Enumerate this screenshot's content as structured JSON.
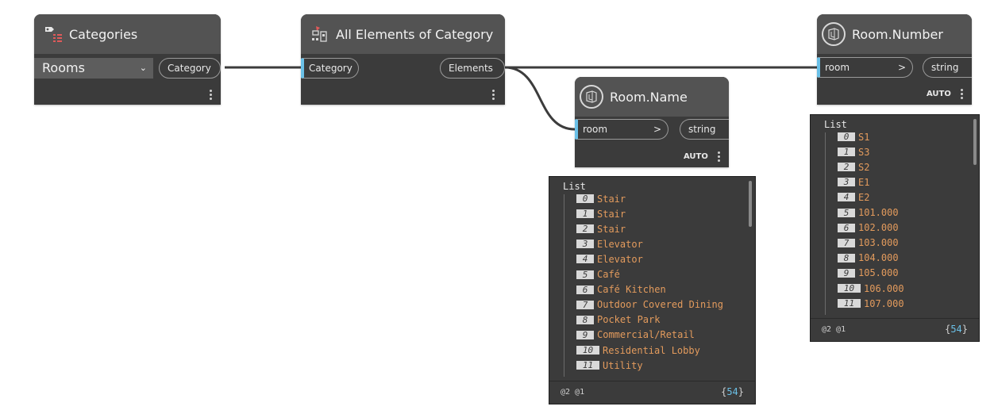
{
  "nodes": {
    "categories": {
      "title": "Categories",
      "dropdown_value": "Rooms",
      "output_label": "Category"
    },
    "all_elements": {
      "title": "All Elements of Category",
      "input_label": "Category",
      "output_label": "Elements"
    },
    "room_name": {
      "title": "Room.Name",
      "input_label": "room",
      "input_arrow": ">",
      "output_label": "string",
      "lacing": "AUTO"
    },
    "room_number": {
      "title": "Room.Number",
      "input_label": "room",
      "input_arrow": ">",
      "output_label": "string",
      "lacing": "AUTO"
    }
  },
  "previews": {
    "room_name": {
      "list_label": "List",
      "items": [
        {
          "index": "0",
          "value": "Stair"
        },
        {
          "index": "1",
          "value": "Stair"
        },
        {
          "index": "2",
          "value": "Stair"
        },
        {
          "index": "3",
          "value": "Elevator"
        },
        {
          "index": "4",
          "value": "Elevator"
        },
        {
          "index": "5",
          "value": "Café"
        },
        {
          "index": "6",
          "value": "Café Kitchen"
        },
        {
          "index": "7",
          "value": "Outdoor Covered Dining"
        },
        {
          "index": "8",
          "value": "Pocket Park"
        },
        {
          "index": "9",
          "value": "Commercial/Retail"
        },
        {
          "index": "10",
          "value": "Residential Lobby"
        },
        {
          "index": "11",
          "value": "Utility"
        }
      ],
      "levels": "@2 @1",
      "count_open": "{",
      "count": "54",
      "count_close": "}"
    },
    "room_number": {
      "list_label": "List",
      "items": [
        {
          "index": "0",
          "value": "S1"
        },
        {
          "index": "1",
          "value": "S3"
        },
        {
          "index": "2",
          "value": "S2"
        },
        {
          "index": "3",
          "value": "E1"
        },
        {
          "index": "4",
          "value": "E2"
        },
        {
          "index": "5",
          "value": "101.000"
        },
        {
          "index": "6",
          "value": "102.000"
        },
        {
          "index": "7",
          "value": "103.000"
        },
        {
          "index": "8",
          "value": "104.000"
        },
        {
          "index": "9",
          "value": "105.000"
        },
        {
          "index": "10",
          "value": "106.000"
        },
        {
          "index": "11",
          "value": "107.000"
        }
      ],
      "levels": "@2 @1",
      "count_open": "{",
      "count": "54",
      "count_close": "}"
    }
  },
  "colors": {
    "wire": "#3c3c3c",
    "node_body": "#3b3b3b",
    "node_header": "#535353",
    "input_accent": "#6ac0e7",
    "value_text": "#e39b5d"
  }
}
